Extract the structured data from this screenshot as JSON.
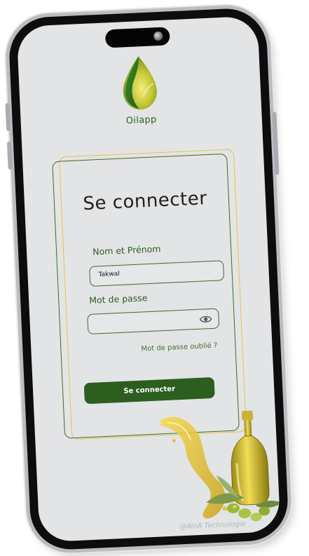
{
  "app": {
    "name": "Oilapp",
    "brand_color": "#2c5e1f",
    "accent_color": "#e1c64a"
  },
  "login": {
    "title": "Se connecter",
    "name_label": "Nom et Prénom",
    "name_value": "Takwal",
    "password_label": "Mot de passe",
    "password_value": "",
    "password_toggle_icon": "eye-icon",
    "forgot_password": "Mot de passe oublié ?",
    "submit_label": "Se connecter"
  },
  "footer": {
    "copyright": "@4InA Technologie"
  }
}
